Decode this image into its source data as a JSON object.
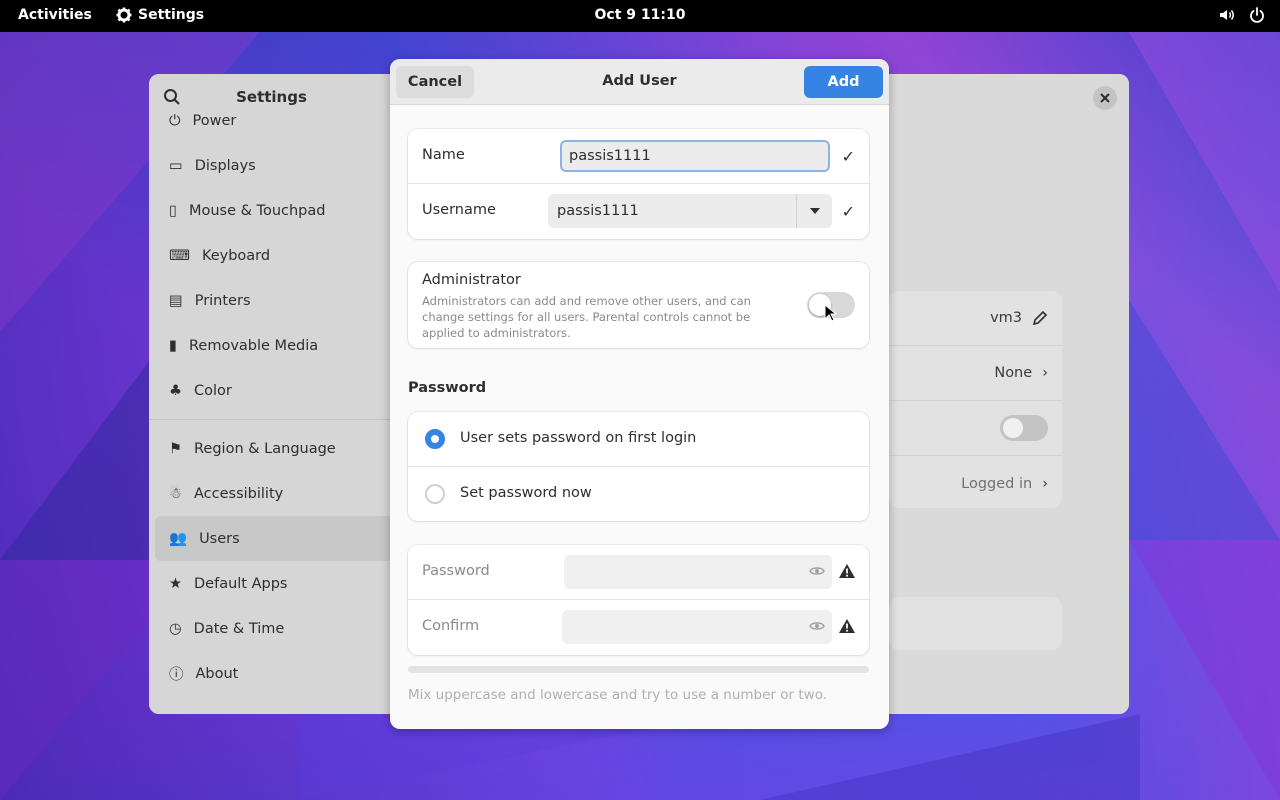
{
  "topbar": {
    "activities": "Activities",
    "app_name": "Settings",
    "clock": "Oct 9  11:10"
  },
  "settings": {
    "title": "Settings",
    "sidebar_items": [
      {
        "label": "Power",
        "icon": "power-icon"
      },
      {
        "label": "Displays",
        "icon": "display-icon"
      },
      {
        "label": "Mouse & Touchpad",
        "icon": "mouse-icon"
      },
      {
        "label": "Keyboard",
        "icon": "keyboard-icon"
      },
      {
        "label": "Printers",
        "icon": "printer-icon"
      },
      {
        "label": "Removable Media",
        "icon": "usb-icon"
      },
      {
        "label": "Color",
        "icon": "color-icon"
      },
      {
        "label": "Region & Language",
        "icon": "flag-icon"
      },
      {
        "label": "Accessibility",
        "icon": "accessibility-icon"
      },
      {
        "label": "Users",
        "icon": "users-icon"
      },
      {
        "label": "Default Apps",
        "icon": "star-icon"
      },
      {
        "label": "Date & Time",
        "icon": "clock-icon"
      },
      {
        "label": "About",
        "icon": "info-icon"
      }
    ],
    "active_item": "Users",
    "user_card": {
      "name": "vm3",
      "account_type": "None",
      "status": "Logged in"
    }
  },
  "dialog": {
    "title": "Add User",
    "cancel_label": "Cancel",
    "add_label": "Add",
    "name_label": "Name",
    "name_value": "passis1111",
    "username_label": "Username",
    "username_value": "passis1111",
    "admin_title": "Administrator",
    "admin_desc": "Administrators can add and remove other users, and can change settings for all users. Parental controls cannot be applied to administrators.",
    "admin_enabled": false,
    "password_section": "Password",
    "option_first_login": "User sets password on first login",
    "option_set_now": "Set password now",
    "selected_option": "first_login",
    "password_label": "Password",
    "confirm_label": "Confirm",
    "hint": "Mix uppercase and lowercase and try to use a number or two."
  },
  "colors": {
    "accent": "#3584e4",
    "topbar": "#000000"
  }
}
